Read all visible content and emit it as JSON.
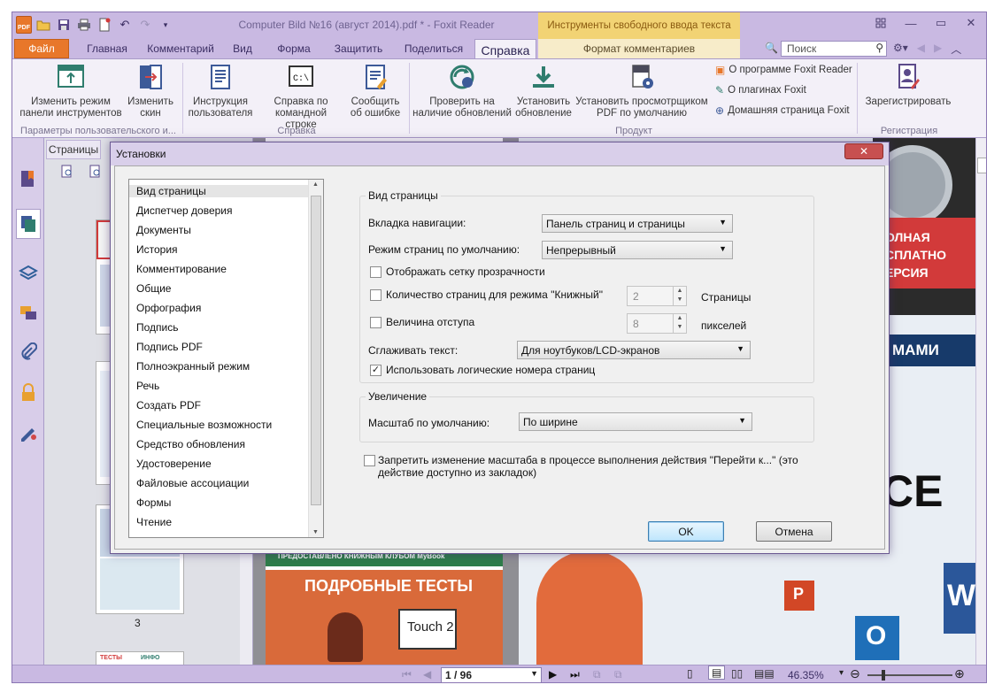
{
  "window": {
    "title": "Computer Bild №16 (август 2014).pdf * - Foxit Reader",
    "context_tab_title": "Инструменты свободного ввода текста",
    "qat_logo": "PDF"
  },
  "tabs": {
    "file": "Файл",
    "home": "Главная",
    "comment": "Комментарий",
    "view": "Вид",
    "form": "Форма",
    "protect": "Защитить",
    "share": "Поделиться",
    "help": "Справка",
    "comment_format": "Формат комментариев",
    "search_placeholder": "Поиск"
  },
  "ribbon": {
    "btn_change_mode": "Изменить режим панели инструментов",
    "btn_change_skin": "Изменить скин",
    "btn_user_guide": "Инструкция пользователя",
    "btn_cmdline_help": "Справка по командной строке",
    "btn_report_bug": "Сообщить об ошибке",
    "btn_check_updates": "Проверить на наличие обновлений",
    "btn_install_update": "Установить обновление",
    "btn_set_default": "Установить просмотрщиком PDF по умолчанию",
    "link_about": "О программе Foxit Reader",
    "link_plugins": "О плагинах Foxit",
    "link_homepage": "Домашняя страница Foxit",
    "btn_register": "Зарегистрировать",
    "group_user_params": "Параметры пользовательского и...",
    "group_help": "Справка",
    "group_product": "Продукт",
    "group_register": "Регистрация",
    "set_default_icon_label": "PDF"
  },
  "pages_panel": {
    "tab_label": "Страницы",
    "page_number": "3"
  },
  "document": {
    "banner_line1": "ОЛНАЯ",
    "banner_line2": "СПЛАТНО",
    "banner_line3": "ЕРСИЯ",
    "heading_mami": "МАМИ",
    "green_bar_text": "ПРЕДОСТАВЛЕНО КНИЖНЫМ КЛУБОМ MyBook",
    "tests_heading": "ПОДРОБНЫЕ ТЕСТЫ",
    "touch_text": "Touch 2",
    "big_letters": "CE",
    "word_letter": "W",
    "outlook_letter": "O",
    "ppt_letter": "P",
    "thumb_tests": "ТЕСТЫ",
    "thumb_info": "ИНФО"
  },
  "statusbar": {
    "page_field": "1 / 96",
    "zoom": "46.35%"
  },
  "dialog": {
    "title": "Установки",
    "categories": [
      "Вид страницы",
      "Диспетчер доверия",
      "Документы",
      "История",
      "Комментирование",
      "Общие",
      "Орфография",
      "Подпись",
      "Подпись PDF",
      "Полноэкранный режим",
      "Речь",
      "Создать PDF",
      "Специальные возможности",
      "Средство обновления",
      "Удостоверение",
      "Файловые ассоциации",
      "Формы",
      "Чтение"
    ],
    "page_view_group": "Вид страницы",
    "nav_tab_label": "Вкладка навигации:",
    "nav_tab_value": "Панель страниц и страницы",
    "page_mode_label": "Режим страниц по умолчанию:",
    "page_mode_value": "Непрерывный",
    "show_grid_label": "Отображать сетку прозрачности",
    "book_pages_label": "Количество страниц для режима \"Книжный\"",
    "book_pages_value": "2",
    "book_pages_unit": "Страницы",
    "margin_label": "Величина отступа",
    "margin_value": "8",
    "margin_unit": "пикселей",
    "smooth_label": "Сглаживать текст:",
    "smooth_value": "Для ноутбуков/LCD-экранов",
    "logical_numbers_label": "Использовать логические номера страниц",
    "zoom_group": "Увеличение",
    "default_zoom_label": "Масштаб по умолчанию:",
    "default_zoom_value": "По ширине",
    "forbid_zoom_label_line1": "Запретить изменение масштаба в процессе выполнения действия \"Перейти к...\" (это",
    "forbid_zoom_label_line2": "действие доступно из закладок)",
    "ok": "OK",
    "cancel": "Отмена"
  }
}
